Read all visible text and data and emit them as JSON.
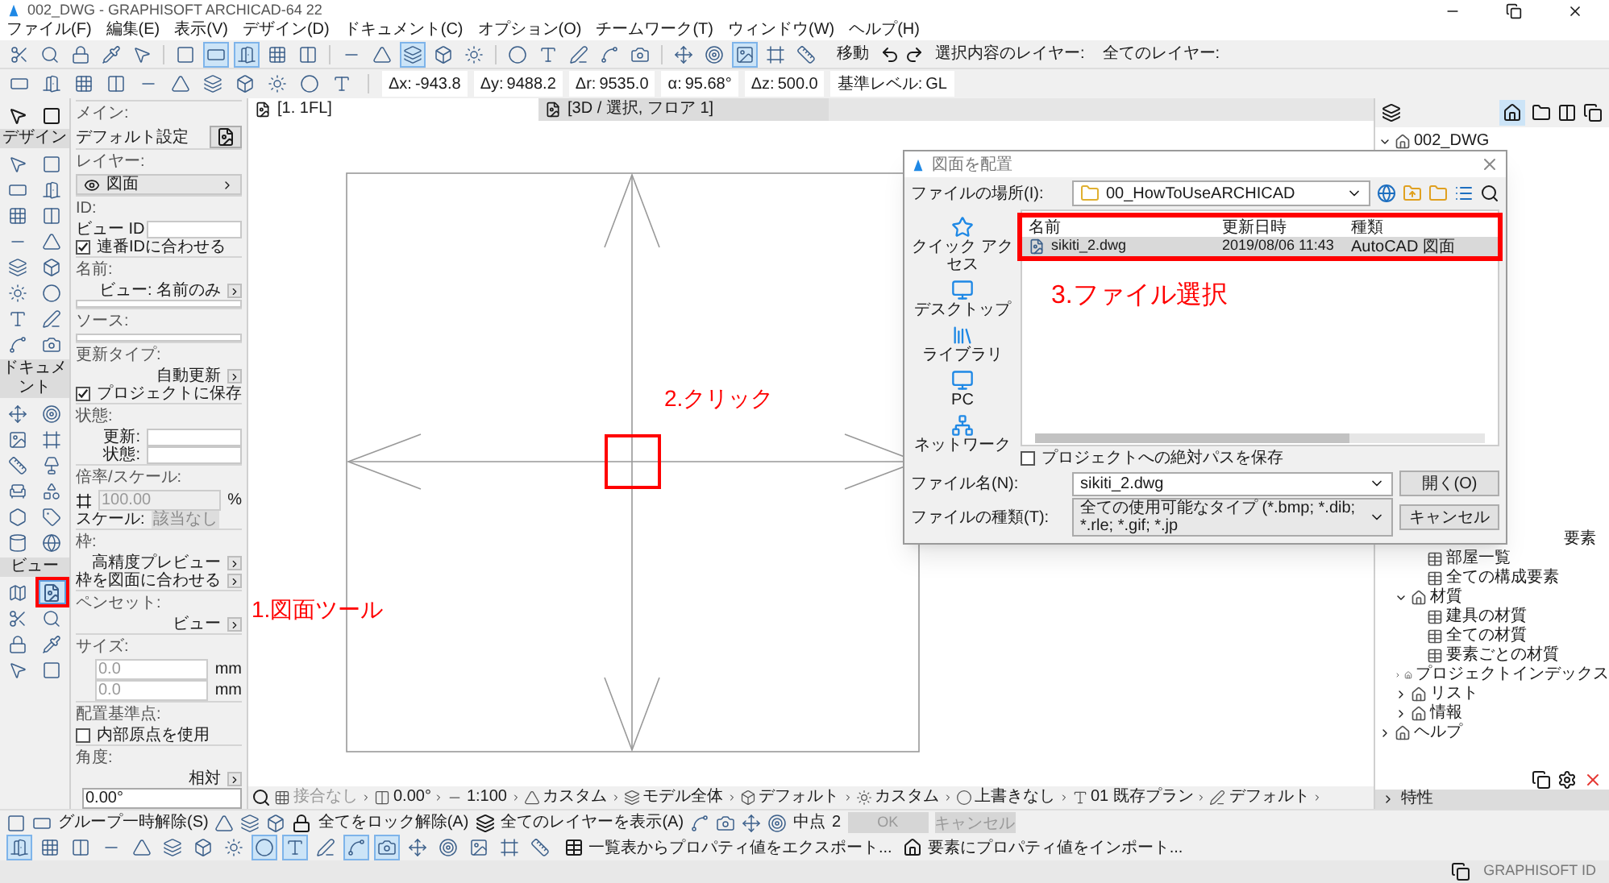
{
  "window": {
    "title": "002_DWG - GRAPHISOFT ARCHICAD-64 22"
  },
  "menu": [
    "ファイル(F)",
    "編集(E)",
    "表示(V)",
    "デザイン(D)",
    "ドキュメント(C)",
    "オプション(O)",
    "チームワーク(T)",
    "ウィンドウ(W)",
    "ヘルプ(H)"
  ],
  "toolbar1": {
    "buttons": [
      {
        "on": false
      },
      {
        "on": false
      },
      {
        "on": false
      },
      {
        "on": false
      },
      {
        "on": false
      },
      {
        "on": false
      },
      {
        "on": true
      },
      {
        "on": true
      },
      {
        "on": false
      },
      {
        "on": false
      },
      {
        "on": false
      },
      {
        "on": false
      },
      {
        "on": true
      },
      {
        "on": false
      },
      {
        "on": false
      },
      {
        "on": false
      },
      {
        "on": false
      },
      {
        "on": false
      },
      {
        "on": false
      },
      {
        "on": false
      },
      {
        "on": false
      },
      {
        "on": false
      },
      {
        "on": true
      },
      {
        "on": false
      },
      {
        "on": false
      }
    ],
    "move_label": "移動",
    "selected_layer_label": "選択内容のレイヤー:",
    "all_layers_label": "全てのレイヤー:"
  },
  "coords": [
    {
      "label": "Δx:",
      "value": "-943.8"
    },
    {
      "label": "Δy:",
      "value": "9488.2"
    },
    {
      "label": "Δr:",
      "value": "9535.0"
    },
    {
      "label": "α:",
      "value": "95.68°"
    },
    {
      "label": "Δz:",
      "value": "500.0"
    },
    {
      "label": "基準レベル:",
      "value": "GL"
    }
  ],
  "toolbox": {
    "sections": [
      {
        "label": "デザイン",
        "tools": [
          {
            "selected": false
          },
          {
            "selected": false
          },
          {
            "selected": false
          },
          {
            "selected": false
          },
          {
            "selected": false
          },
          {
            "selected": false
          },
          {
            "selected": false
          },
          {
            "selected": false
          },
          {
            "selected": false
          },
          {
            "selected": false
          },
          {
            "selected": false
          },
          {
            "selected": false
          },
          {
            "selected": false
          },
          {
            "selected": false
          },
          {
            "selected": false
          },
          {
            "selected": false
          }
        ]
      },
      {
        "label": "ドキュメント",
        "tools": [
          {
            "selected": false
          },
          {
            "selected": false
          },
          {
            "selected": false
          },
          {
            "selected": false
          },
          {
            "selected": false
          },
          {
            "selected": false
          },
          {
            "selected": false
          },
          {
            "selected": false
          },
          {
            "selected": false
          },
          {
            "selected": false
          },
          {
            "selected": false
          },
          {
            "selected": false
          }
        ]
      },
      {
        "label": "ビュー",
        "tools": [
          {
            "selected": false
          },
          {
            "selected": true
          },
          {
            "selected": false
          },
          {
            "selected": false
          },
          {
            "selected": false
          },
          {
            "selected": false
          },
          {
            "selected": false
          },
          {
            "selected": false
          }
        ]
      }
    ]
  },
  "infobox": [
    {
      "kind": "heading",
      "text": "メイン:"
    },
    {
      "kind": "setting",
      "text": "デフォルト設定"
    },
    {
      "kind": "heading",
      "text": "レイヤー:"
    },
    {
      "kind": "layer",
      "text": "図面"
    },
    {
      "kind": "heading",
      "text": "ID:"
    },
    {
      "kind": "field",
      "label": "ビュー ID"
    },
    {
      "kind": "checkbox",
      "text": "連番IDに合わせる",
      "checked": true
    },
    {
      "kind": "heading",
      "text": "名前:"
    },
    {
      "kind": "menu",
      "text": "ビュー: 名前のみ"
    },
    {
      "kind": "blank"
    },
    {
      "kind": "heading",
      "text": "ソース:"
    },
    {
      "kind": "blank"
    },
    {
      "kind": "heading",
      "text": "更新タイプ:"
    },
    {
      "kind": "menu",
      "text": "自動更新"
    },
    {
      "kind": "checkbox",
      "text": "プロジェクトに保存",
      "checked": true
    },
    {
      "kind": "heading",
      "text": "状態:"
    },
    {
      "kind": "field",
      "label": "更新:"
    },
    {
      "kind": "field",
      "label": "状態:"
    },
    {
      "kind": "heading",
      "text": "倍率/スケール:"
    },
    {
      "kind": "percent",
      "value": "100.00",
      "unit": "%"
    },
    {
      "kind": "select",
      "label": "スケール:",
      "value": "該当なし"
    },
    {
      "kind": "heading",
      "text": "枠:"
    },
    {
      "kind": "menu",
      "text": "高精度プレビュー"
    },
    {
      "kind": "menu",
      "text": "枠を図面に合わせる"
    },
    {
      "kind": "heading",
      "text": "ペンセット:"
    },
    {
      "kind": "menu",
      "text": "ビュー"
    },
    {
      "kind": "heading",
      "text": "サイズ:"
    },
    {
      "kind": "size",
      "value": "0.0",
      "unit": "mm"
    },
    {
      "kind": "size",
      "value": "0.0",
      "unit": "mm"
    },
    {
      "kind": "heading",
      "text": "配置基準点:"
    },
    {
      "kind": "checkbox",
      "text": "内部原点を使用",
      "checked": false
    },
    {
      "kind": "heading",
      "text": "角度:"
    },
    {
      "kind": "menu",
      "text": "相対"
    },
    {
      "kind": "angle",
      "value": "0.00°"
    }
  ],
  "tabs": [
    {
      "label": "[1. 1FL]",
      "selected": true
    },
    {
      "label": "[3D / 選択, フロア 1]",
      "selected": false
    }
  ],
  "annotations": [
    {
      "text": "1.図面ツール"
    },
    {
      "text": "2.クリック"
    },
    {
      "text": "3.ファイル選択"
    }
  ],
  "dialog": {
    "title": "図面を配置",
    "location_label": "ファイルの場所(I):",
    "location": "00_HowToUseARCHICAD",
    "places": [
      "クイック アクセス",
      "デスクトップ",
      "ライブラリ",
      "PC",
      "ネットワーク"
    ],
    "columns": [
      "名前",
      "更新日時",
      "種類"
    ],
    "rows": [
      {
        "name": "sikiti_2.dwg",
        "date": "2019/08/06 11:43",
        "type": "AutoCAD 図面",
        "selected": true
      }
    ],
    "checkbox": {
      "label": "プロジェクトへの絶対パスを保存",
      "checked": false
    },
    "filename_label": "ファイル名(N):",
    "filename": "sikiti_2.dwg",
    "filetype_label": "ファイルの種類(T):",
    "filetype": "全ての使用可能なタイプ (*.bmp; *.dib; *.rle; *.gif; *.jp",
    "buttons": [
      "開く(O)",
      "キャンセル"
    ]
  },
  "navigator": {
    "tree": [
      {
        "label": "002_DWG",
        "expanded": true,
        "children": [
          {
            "label": "要素",
            "partial": true,
            "children": [
              {
                "label": "部屋一覧"
              },
              {
                "label": "全ての構成要素"
              }
            ]
          },
          {
            "label": "材質",
            "expanded": true,
            "children": [
              {
                "label": "建具の材質"
              },
              {
                "label": "全ての材質"
              },
              {
                "label": "要素ごとの材質"
              }
            ]
          },
          {
            "label": "プロジェクトインデックス",
            "expanded": false
          },
          {
            "label": "リスト",
            "expanded": false
          },
          {
            "label": "情報",
            "expanded": false
          }
        ]
      },
      {
        "label": "ヘルプ",
        "expanded": false
      }
    ],
    "properties_label": "特性"
  },
  "bottom1": [
    {
      "text": "接合なし",
      "disabled": true
    },
    {
      "text": "0.00°",
      "disabled": false
    },
    {
      "text": "1:100",
      "disabled": false
    },
    {
      "text": "カスタム",
      "disabled": false
    },
    {
      "text": "モデル全体",
      "disabled": false
    },
    {
      "text": "デフォルト",
      "disabled": false
    },
    {
      "text": "カスタム",
      "disabled": false
    },
    {
      "text": "上書きなし",
      "disabled": false
    },
    {
      "text": "01 既存プラン",
      "disabled": false
    },
    {
      "text": "デフォルト",
      "disabled": false
    }
  ],
  "bottom2": {
    "ungroup": "グループ一時解除(S)",
    "unlock": "全てをロック解除(A)",
    "show_layers": "全てのレイヤーを表示(A)",
    "snap_label": "中点",
    "snap_value": "2",
    "ok": "OK",
    "cancel": "キャンセル"
  },
  "bottom3": {
    "buttons": [
      {
        "on": true
      },
      {
        "on": false
      },
      {
        "on": false
      },
      {
        "on": false
      },
      {
        "on": false
      },
      {
        "on": false
      },
      {
        "on": false
      },
      {
        "on": false
      },
      {
        "on": true
      },
      {
        "on": true
      },
      {
        "on": false
      },
      {
        "on": true
      },
      {
        "on": true
      },
      {
        "on": false
      },
      {
        "on": false
      },
      {
        "on": false
      },
      {
        "on": false
      },
      {
        "on": false
      }
    ],
    "export": "一覧表からプロパティ値をエクスポート...",
    "import": "要素にプロパティ値をインポート..."
  },
  "status": {
    "account": "GRAPHISOFT ID"
  }
}
